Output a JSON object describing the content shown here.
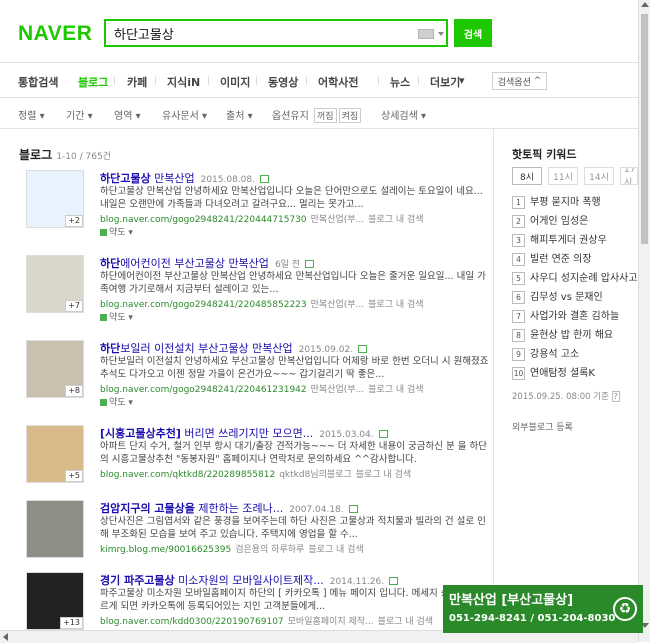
{
  "header": {
    "logo": "NAVER",
    "search_value": "하단고물상",
    "search_button": "검색"
  },
  "nav": {
    "tabs": [
      "통합검색",
      "블로그",
      "카페",
      "지식iN",
      "이미지",
      "동영상",
      "어학사전",
      "뉴스",
      "더보기"
    ],
    "options_button": "검색옵션"
  },
  "filters": {
    "items": [
      "정렬",
      "기간",
      "영역",
      "유사문서",
      "출처",
      "옵션유지",
      "상세검색"
    ],
    "keep_on": "꺼짐",
    "keep_off": "켜짐"
  },
  "results": {
    "heading": "블로그",
    "count": "1-10 / 765건",
    "items": [
      {
        "title_bold": "하단고물상",
        "title_rest": " 만복산업",
        "date": "2015.08.08.",
        "desc": "하단고물상 만복산업 안녕하세요 만복산업입니다 오늘은 단어만으로도 설레이는 토요일이 네요... 내일은 오랜만에 가족들과 다녀오려고 갈려구요... 멀리는 못가고...",
        "url": "blog.naver.com/gogo2948241/220444715730",
        "meta": "만복산업(부...",
        "inner": "블로그 내 검색",
        "route": "약도",
        "badge": "+2"
      },
      {
        "title_bold": "하단",
        "title_rest": "에어컨이전 부산고물상 만복산업",
        "date": "6일 전",
        "desc": "하단에어컨이전 부산고물상 만복산업 안녕하세요 만복산업입니다 오늘은 줄거운 일요일... 내일 가족여행 가기로해서 지금부터 설레이고 있는...",
        "url": "blog.naver.com/gogo2948241/220485852223",
        "meta": "만복산업(부...",
        "inner": "블로그 내 검색",
        "route": "약도",
        "badge": "+7"
      },
      {
        "title_bold": "하단",
        "title_rest": "보일러 이전설치 부산고물상 만복산업",
        "date": "2015.09.02.",
        "desc": "하단보일러 이전설치 안녕하세요 부산고물상 만복산업입니다 어제랑 바로 한번 오더니 시 원해졌죠 추석도 다가오고 이젠 정말 가을이 온건가요~~~ 갑기걸리기 딱 좋은...",
        "url": "blog.naver.com/gogo2948241/220461231942",
        "meta": "만복산업(부...",
        "inner": "블로그 내 검색",
        "route": "약도",
        "badge": "+8"
      },
      {
        "title_bold": "[시흥고물상추천]",
        "title_rest": " 버리면 쓰레기지만 모으면...",
        "date": "2015.03.04.",
        "desc": "아파트 단지 수거, 철거 인부 항시 대기/출장 견적가능~~~ 더 자세한 내용이 궁금하신 분 을 하단의 시흥고물상추천 \"동봉자원\" 홈페이지나 연락처로 문의하세요 ^^감사합니다.",
        "url": "blog.naver.com/qktkd8/220289855812",
        "meta": "qktkd8님의블로그",
        "inner": "블로그 내 검색",
        "route": "",
        "badge": "+5"
      },
      {
        "title_bold": "검암지구의 고물상을",
        "title_rest": " 제한하는 조례나...",
        "date": "2007.04.18.",
        "desc": "상단사진은 그림엽서와 같은 풍경을 보여주는데 하단 사진은 고물상과 적치물과 빌라의 건 설로 인해 부조화된 모습을 보여 주고 있습니다. 주택지에 영업을 할 수...",
        "url": "kimrg.blog.me/90016625395",
        "meta": "검은용의 하루하루",
        "inner": "블로그 내 검색",
        "route": "",
        "badge": ""
      },
      {
        "title_bold": "경기 파주고물상",
        "title_rest": " 미소자원의 모바일사이트제작...",
        "date": "2014.11.26.",
        "desc": "파주고물상 미소자원 모바일홈페이지 하단의 [ 카카오톡 ] 메뉴 페이지 입니다. 메세지 송하기를 누르게 되면 카카오톡에 등록되어있는 지인 고객분들에게...",
        "url": "blog.naver.com/kdd0300/220190769107",
        "meta": "모바일홈페이지 제작...",
        "inner": "블로그 내 검색",
        "route": "",
        "badge": "+13"
      }
    ]
  },
  "hot": {
    "title": "핫토픽 키워드",
    "tabs": [
      "8시",
      "11시",
      "14시",
      "17시"
    ],
    "keywords": [
      "부평 묻지마 폭행",
      "어게인 임성은",
      "해피투게더 권상우",
      "빌런 연준 의장",
      "사우디 성지순례 압사사고",
      "김무성 vs 문재인",
      "사업가와 결혼 김하늘",
      "윤현상 밥 한끼 해요",
      "강용석 고소",
      "연애탐정 셜록K"
    ],
    "stamp": "2015.09.25. 08:00 기준",
    "ext_link": "외부블로그 등록"
  },
  "banner": {
    "line1": "만복산업 [부산고물상]",
    "line2": "051-294-8241 / 051-204-8030"
  },
  "colors": {
    "brand": "#1ec800",
    "link": "#1a0dab",
    "url": "#2b8a2b",
    "banner": "#2a8a2a"
  }
}
